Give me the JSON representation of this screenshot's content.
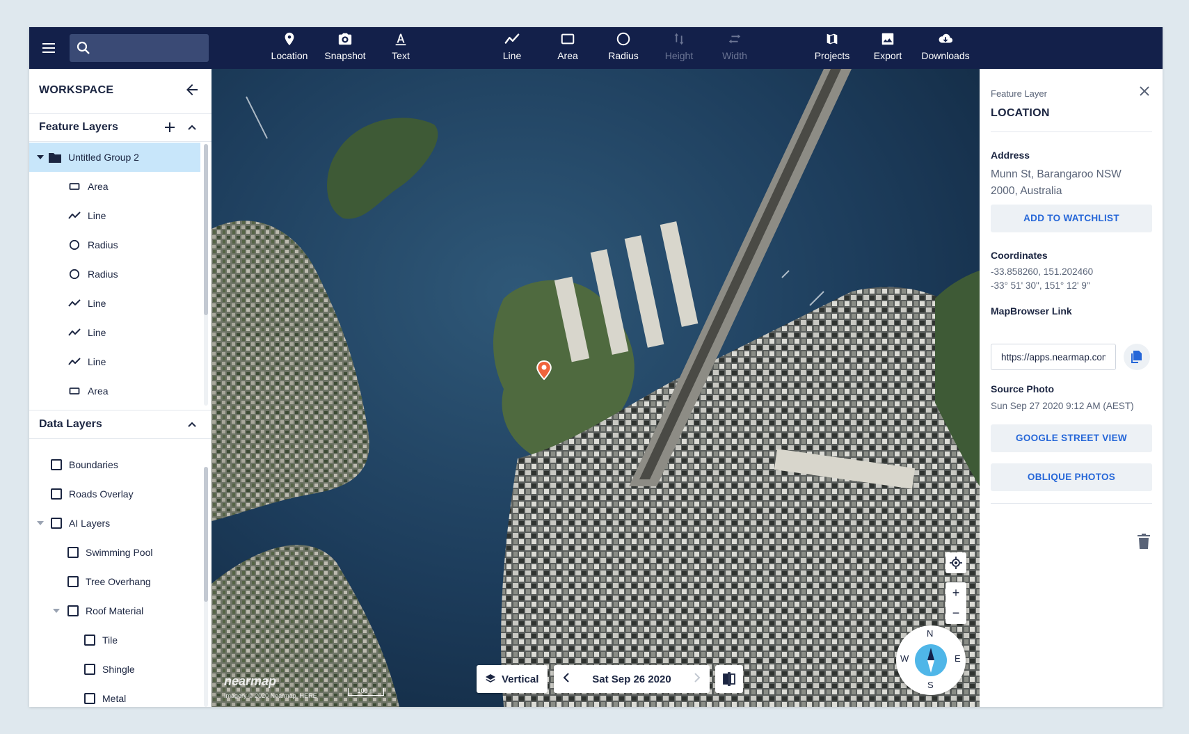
{
  "search": {
    "placeholder": ""
  },
  "toolbar": {
    "tools": [
      {
        "label": "Location",
        "icon": "location-pin-icon"
      },
      {
        "label": "Snapshot",
        "icon": "camera-icon"
      },
      {
        "label": "Text",
        "icon": "text-icon"
      },
      {
        "label": "Line",
        "icon": "polyline-icon"
      },
      {
        "label": "Area",
        "icon": "rectangle-icon"
      },
      {
        "label": "Radius",
        "icon": "circle-icon"
      },
      {
        "label": "Height",
        "icon": "height-arrows-icon",
        "disabled": true
      },
      {
        "label": "Width",
        "icon": "width-arrows-icon",
        "disabled": true
      },
      {
        "label": "Projects",
        "icon": "map-icon"
      },
      {
        "label": "Export",
        "icon": "image-icon"
      },
      {
        "label": "Downloads",
        "icon": "cloud-download-icon"
      }
    ]
  },
  "sidebar": {
    "title": "WORKSPACE",
    "feature_layers": {
      "title": "Feature Layers",
      "group": "Untitled Group 2",
      "items": [
        {
          "label": "Area",
          "icon": "rectangle-icon"
        },
        {
          "label": "Line",
          "icon": "polyline-icon"
        },
        {
          "label": "Radius",
          "icon": "circle-icon"
        },
        {
          "label": "Radius",
          "icon": "circle-icon"
        },
        {
          "label": "Line",
          "icon": "polyline-icon"
        },
        {
          "label": "Line",
          "icon": "polyline-icon"
        },
        {
          "label": "Line",
          "icon": "polyline-icon"
        },
        {
          "label": "Area",
          "icon": "rectangle-icon"
        }
      ]
    },
    "data_layers": {
      "title": "Data Layers",
      "items": [
        {
          "label": "Boundaries",
          "level": 0
        },
        {
          "label": "Roads Overlay",
          "level": 0
        },
        {
          "label": "AI Layers",
          "level": 0,
          "expandable": true
        },
        {
          "label": "Swimming Pool",
          "level": 1
        },
        {
          "label": "Tree Overhang",
          "level": 1
        },
        {
          "label": "Roof Material",
          "level": 1,
          "expandable": true
        },
        {
          "label": "Tile",
          "level": 2
        },
        {
          "label": "Shingle",
          "level": 2
        },
        {
          "label": "Metal",
          "level": 2
        }
      ]
    }
  },
  "map": {
    "view_mode": "Vertical",
    "date": "Sat Sep 26 2020",
    "watermark": "nearmap",
    "attribution": "Imagery © 2020 Nearmap, HERE",
    "scale": "100 m",
    "compass": {
      "n": "N",
      "e": "E",
      "s": "S",
      "w": "W"
    },
    "zoom_in": "+",
    "zoom_out": "−"
  },
  "panel": {
    "subtitle": "Feature Layer",
    "title": "LOCATION",
    "address_label": "Address",
    "address": "Munn St, Barangaroo NSW 2000, Australia",
    "watchlist_button": "ADD TO WATCHLIST",
    "coordinates_label": "Coordinates",
    "coordinates_decimal": "-33.858260, 151.202460",
    "coordinates_dms": "-33° 51' 30\", 151° 12' 9\"",
    "link_label": "MapBrowser Link",
    "link_value": "https://apps.nearmap.com",
    "source_label": "Source Photo",
    "source_value": "Sun Sep 27 2020 9:12 AM (AEST)",
    "street_view_button": "GOOGLE STREET VIEW",
    "oblique_button": "OBLIQUE PHOTOS"
  },
  "colors": {
    "topbar": "#13204a",
    "accent": "#2566d8",
    "selected_row": "#c8e6fa",
    "marker": "#f0643c",
    "compass_needle": "#4fb6e8"
  }
}
